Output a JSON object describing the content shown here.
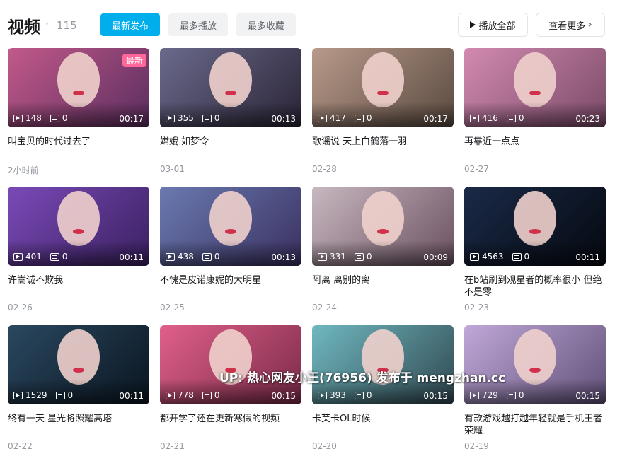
{
  "header": {
    "title": "视频",
    "dot": "·",
    "count": "115",
    "sort_tabs": [
      "最新发布",
      "最多播放",
      "最多收藏"
    ],
    "play_all": "播放全部",
    "see_more": "查看更多"
  },
  "videos": [
    {
      "title": "叫宝贝的时代过去了",
      "date": "2小时前",
      "views": "148",
      "danmaku": "0",
      "duration": "00:17",
      "badge": "最新",
      "colors": [
        "#c25a8a",
        "#5a2d5e"
      ]
    },
    {
      "title": "嫦娥 如梦令",
      "date": "03-01",
      "views": "355",
      "danmaku": "0",
      "duration": "00:13",
      "badge": "",
      "colors": [
        "#6b6a8c",
        "#2a2436"
      ]
    },
    {
      "title": "歌谣说 天上白鹤落一羽",
      "date": "02-28",
      "views": "417",
      "danmaku": "0",
      "duration": "00:17",
      "badge": "",
      "colors": [
        "#b89a8a",
        "#5a4a40"
      ]
    },
    {
      "title": "再靠近一点点",
      "date": "02-27",
      "views": "416",
      "danmaku": "0",
      "duration": "00:23",
      "badge": "",
      "colors": [
        "#d28ab0",
        "#7a4a68"
      ]
    },
    {
      "title": "许嵩诚不欺我",
      "date": "02-26",
      "views": "401",
      "danmaku": "0",
      "duration": "00:11",
      "badge": "",
      "colors": [
        "#7a4ab8",
        "#3a2060"
      ]
    },
    {
      "title": "不愧是皮诺康妮的大明星",
      "date": "02-25",
      "views": "438",
      "danmaku": "0",
      "duration": "00:13",
      "badge": "",
      "colors": [
        "#6a7ab0",
        "#3a3060"
      ]
    },
    {
      "title": "阿离 离别的离",
      "date": "02-24",
      "views": "331",
      "danmaku": "0",
      "duration": "00:09",
      "badge": "",
      "colors": [
        "#c8b8c0",
        "#6a5060"
      ]
    },
    {
      "title": "在b站刷到观星者的概率很小 但绝不是零",
      "date": "02-23",
      "views": "4563",
      "danmaku": "0",
      "duration": "00:11",
      "badge": "",
      "colors": [
        "#1a2a48",
        "#05080f"
      ]
    },
    {
      "title": "终有一天 星光将照耀高塔",
      "date": "02-22",
      "views": "1529",
      "danmaku": "0",
      "duration": "00:11",
      "badge": "",
      "colors": [
        "#2a4860",
        "#0a1520"
      ]
    },
    {
      "title": "都开学了还在更新寒假的视频",
      "date": "02-21",
      "views": "778",
      "danmaku": "0",
      "duration": "00:15",
      "badge": "",
      "colors": [
        "#e0608a",
        "#7a2a48"
      ]
    },
    {
      "title": "卡芙卡OL时候",
      "date": "02-20",
      "views": "393",
      "danmaku": "0",
      "duration": "00:15",
      "badge": "",
      "colors": [
        "#70b8c0",
        "#304850"
      ]
    },
    {
      "title": "有款游戏越打越年轻就是手机王者荣耀",
      "date": "02-19",
      "views": "729",
      "danmaku": "0",
      "duration": "00:15",
      "badge": "",
      "colors": [
        "#c0a8d8",
        "#605078"
      ]
    }
  ],
  "watermark": "UP: 热心网友小王(76956) 发布于 mengzhan.cc",
  "icons": {
    "play_all": "play-icon",
    "see_more": "chevron-right-icon",
    "views": "play-count-icon",
    "danmaku": "danmaku-icon"
  },
  "colors": {
    "accent": "#00aeec",
    "badge": "#ff6699"
  }
}
